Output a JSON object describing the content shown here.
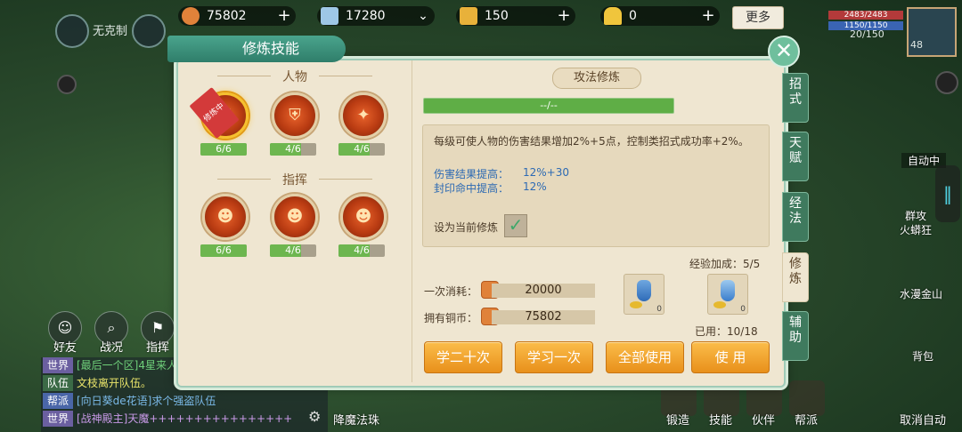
{
  "currencies": [
    {
      "icon": "copper-coin-icon",
      "value": "75802",
      "action": "+"
    },
    {
      "icon": "scroll-icon",
      "value": "17280",
      "action": "⌄"
    },
    {
      "icon": "gold-scroll-icon",
      "value": "150",
      "action": "+"
    },
    {
      "icon": "gold-ingot-icon",
      "value": "0",
      "action": "+"
    }
  ],
  "more_label": "更多",
  "hud": {
    "mode_label": "无克制",
    "hp": "2483/2483",
    "mp": "1150/1150",
    "sp": "20/150",
    "level": "48",
    "auto_label": "自动中",
    "side_items": [
      "群攻",
      "火蟒狂",
      "水漫金山",
      "背包"
    ]
  },
  "left_buttons": [
    {
      "label": "好友",
      "icon": "friends-icon"
    },
    {
      "label": "战况",
      "icon": "search-icon"
    },
    {
      "label": "指挥",
      "icon": "flag-icon"
    }
  ],
  "chat": [
    {
      "tag": "世界",
      "text": "[最后一个区]4星来人"
    },
    {
      "tag": "队伍",
      "text": "文枝离开队伍。"
    },
    {
      "tag": "帮派",
      "text": "[向日葵de花语]求个强盗队伍"
    },
    {
      "tag": "世界",
      "text": "[战神殿主]天魔++++++++++++++++"
    }
  ],
  "bottom_bar": [
    "降魔法珠",
    "锻造",
    "技能",
    "伙伴",
    "帮派",
    "取消自动"
  ],
  "dialog": {
    "title": "修炼技能",
    "close": "✕",
    "sections": [
      {
        "title": "人物",
        "skills": [
          {
            "name": "attack-cultivation",
            "level": "6/6",
            "progress": 1.0,
            "badge": "修炼中",
            "active": true
          },
          {
            "name": "defense-cultivation",
            "level": "4/6",
            "progress": 0.667,
            "badge": "",
            "active": false
          },
          {
            "name": "magic-cultivation",
            "level": "4/6",
            "progress": 0.667,
            "badge": "",
            "active": false
          }
        ]
      },
      {
        "title": "指挥",
        "skills": [
          {
            "name": "command-1",
            "level": "6/6",
            "progress": 1.0,
            "badge": "",
            "active": false
          },
          {
            "name": "command-2",
            "level": "4/6",
            "progress": 0.667,
            "badge": "",
            "active": false
          },
          {
            "name": "command-3",
            "level": "4/6",
            "progress": 0.667,
            "badge": "",
            "active": false
          }
        ]
      }
    ],
    "detail": {
      "header": "攻法修炼",
      "exp_text": "--/--",
      "description": "每级可使人物的伤害结果增加2%+5点，控制类招式成功率+2%。",
      "stats": [
        {
          "label": "伤害结果提高：",
          "value": "12%+30"
        },
        {
          "label": "封印命中提高：",
          "value": "12%"
        }
      ],
      "set_current_label": "设为当前修炼",
      "set_current_checked": "✓",
      "cost_once_label": "一次消耗：",
      "cost_once_value": "20000",
      "owned_label": "拥有铜币：",
      "owned_value": "75802",
      "exp_bonus_label": "经验加成：5/5",
      "used_label": "已用：10/18",
      "items": [
        {
          "count": "0"
        },
        {
          "count": "0"
        }
      ],
      "buttons": {
        "learn_twenty": "学二十次",
        "learn_once": "学习一次",
        "use_all": "全部使用",
        "use": "使 用"
      }
    },
    "tabs": [
      "招式",
      "天赋",
      "经法",
      "修炼",
      "辅助"
    ],
    "active_tab": "修炼"
  }
}
